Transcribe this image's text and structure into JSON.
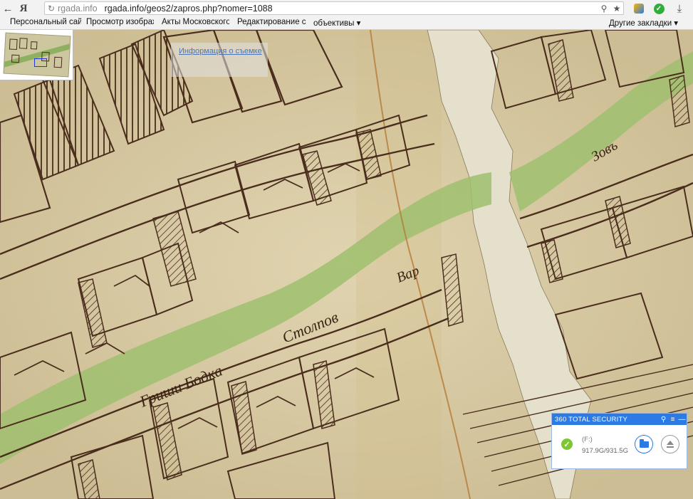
{
  "browser": {
    "brand_glyph": "Я",
    "back_glyph": "←",
    "address": {
      "domain": "rgada.info",
      "url": "rgada.info/geos2/zapros.php?nomer=1088"
    },
    "bookmarks": [
      {
        "label": "Персональный сайт"
      },
      {
        "label": "Просмотр изображ"
      },
      {
        "label": "Акты Московского"
      },
      {
        "label": "Редактирование со"
      },
      {
        "label": "объективы ▾"
      }
    ],
    "other_bookmarks": "Другие закладки ▾"
  },
  "viewer": {
    "info_link": "Информация о съемке",
    "map_inscriptions": [
      "Гриши Бодка",
      "Столпов",
      "Вар",
      "Зовъ"
    ]
  },
  "security_popup": {
    "title": "360 TOTAL SECURITY",
    "drive_name": "(F:)",
    "drive_size": "917.9G/931.5G",
    "colors": {
      "header": "#2c7be5",
      "ok": "#7ec632"
    }
  }
}
